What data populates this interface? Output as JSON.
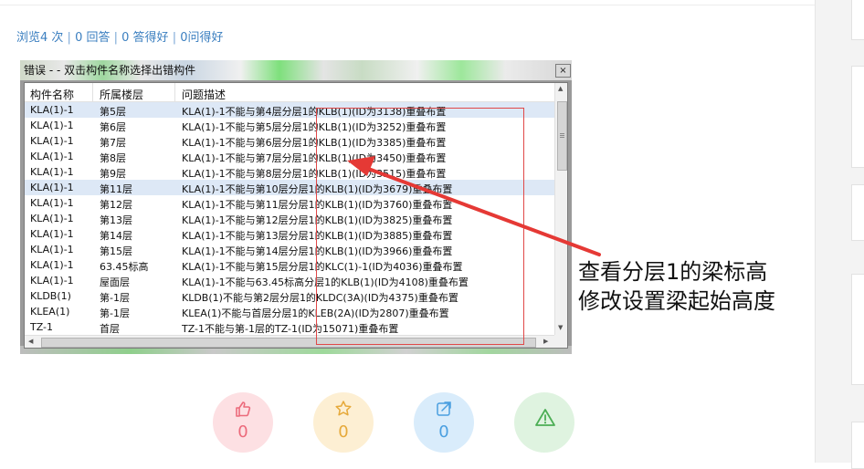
{
  "stats": {
    "views": "浏览4 次",
    "answers": "0 回答",
    "good_answers": "0 答得好",
    "good_questions": "0问得好",
    "separator": "|"
  },
  "dialog": {
    "title": "错误 -  - 双击构件名称选择出错构件",
    "close_glyph": "×",
    "columns": [
      "构件名称",
      "所属楼层",
      "问题描述"
    ],
    "rows": [
      {
        "name": "KLA(1)-1",
        "floor": "第5层",
        "desc": "KLA(1)-1不能与第4层分层1的KLB(1)(ID为3138)重叠布置",
        "selected": true
      },
      {
        "name": "KLA(1)-1",
        "floor": "第6层",
        "desc": "KLA(1)-1不能与第5层分层1的KLB(1)(ID为3252)重叠布置",
        "selected": false
      },
      {
        "name": "KLA(1)-1",
        "floor": "第7层",
        "desc": "KLA(1)-1不能与第6层分层1的KLB(1)(ID为3385)重叠布置",
        "selected": false
      },
      {
        "name": "KLA(1)-1",
        "floor": "第8层",
        "desc": "KLA(1)-1不能与第7层分层1的KLB(1)(ID为3450)重叠布置",
        "selected": false
      },
      {
        "name": "KLA(1)-1",
        "floor": "第9层",
        "desc": "KLA(1)-1不能与第8层分层1的KLB(1)(ID为3515)重叠布置",
        "selected": false
      },
      {
        "name": "KLA(1)-1",
        "floor": "第11层",
        "desc": "KLA(1)-1不能与第10层分层1的KLB(1)(ID为3679)重叠布置",
        "selected": true
      },
      {
        "name": "KLA(1)-1",
        "floor": "第12层",
        "desc": "KLA(1)-1不能与第11层分层1的KLB(1)(ID为3760)重叠布置",
        "selected": false
      },
      {
        "name": "KLA(1)-1",
        "floor": "第13层",
        "desc": "KLA(1)-1不能与第12层分层1的KLB(1)(ID为3825)重叠布置",
        "selected": false
      },
      {
        "name": "KLA(1)-1",
        "floor": "第14层",
        "desc": "KLA(1)-1不能与第13层分层1的KLB(1)(ID为3885)重叠布置",
        "selected": false
      },
      {
        "name": "KLA(1)-1",
        "floor": "第15层",
        "desc": "KLA(1)-1不能与第14层分层1的KLB(1)(ID为3966)重叠布置",
        "selected": false
      },
      {
        "name": "KLA(1)-1",
        "floor": "63.45标高",
        "desc": "KLA(1)-1不能与第15层分层1的KLC(1)-1(ID为4036)重叠布置",
        "selected": false
      },
      {
        "name": "KLA(1)-1",
        "floor": "屋面层",
        "desc": "KLA(1)-1不能与63.45标高分层1的KLB(1)(ID为4108)重叠布置",
        "selected": false
      },
      {
        "name": "KLDB(1)",
        "floor": "第-1层",
        "desc": "KLDB(1)不能与第2层分层1的KLDC(3A)(ID为4375)重叠布置",
        "selected": false
      },
      {
        "name": "KLEA(1)",
        "floor": "第-1层",
        "desc": "KLEA(1)不能与首层分层1的KLEB(2A)(ID为2807)重叠布置",
        "selected": false
      },
      {
        "name": "TZ-1",
        "floor": "首层",
        "desc": "TZ-1不能与第-1层的TZ-1(ID为15071)重叠布置",
        "selected": false
      }
    ]
  },
  "annotation": {
    "line1": "查看分层1的梁标高",
    "line2": "修改设置梁起始高度",
    "color": "#e53935"
  },
  "actions": [
    {
      "id": "like",
      "icon": "thumbs-up-icon",
      "count": "0",
      "bg": "#fde0e3",
      "fg": "#ec6a7b"
    },
    {
      "id": "favorite",
      "icon": "star-icon",
      "count": "0",
      "bg": "#fdefd3",
      "fg": "#e6a93a"
    },
    {
      "id": "share",
      "icon": "share-icon",
      "count": "0",
      "bg": "#d9ecfb",
      "fg": "#4a9fe0"
    },
    {
      "id": "report",
      "icon": "warning-icon",
      "count": "",
      "bg": "#dff3e0",
      "fg": "#4cae55"
    }
  ]
}
